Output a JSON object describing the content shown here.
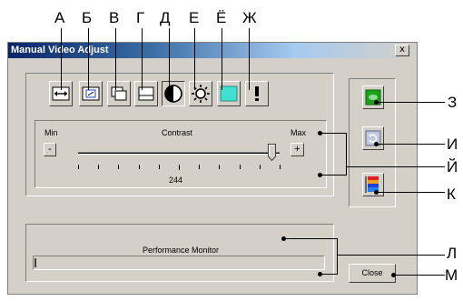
{
  "letters": {
    "a": "А",
    "b": "Б",
    "v": "В",
    "g": "Г",
    "d": "Д",
    "e": "Е",
    "yo": "Ё",
    "zh": "Ж",
    "z": "З",
    "i": "И",
    "iy": "Й",
    "k": "К",
    "l": "Л",
    "m": "М"
  },
  "window": {
    "title": "Manual Video Adjust",
    "close_glyph": "x"
  },
  "slider": {
    "min_label": "Min",
    "max_label": "Max",
    "name": "Contrast",
    "value": "244",
    "level": 0.96,
    "minus_label": "-",
    "plus_label": "+"
  },
  "performance": {
    "label": "Performance Monitor"
  },
  "close_button": "Close",
  "colors": {
    "title_start": "#0a246a",
    "green_button": "#1aa31a",
    "cyan_swatch": "#40e0d0"
  }
}
